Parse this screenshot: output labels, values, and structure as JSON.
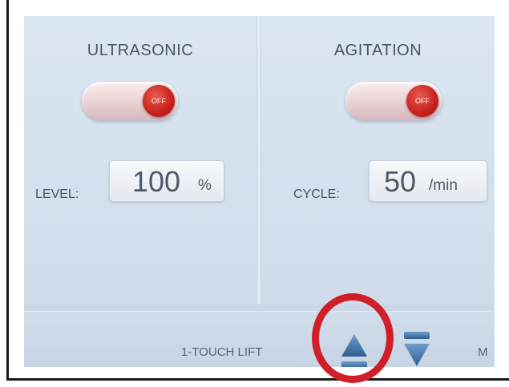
{
  "ultrasonic": {
    "title": "ULTRASONIC",
    "toggle_state": "OFF",
    "level_label": "LEVEL:",
    "level_value": "100",
    "level_unit": "%"
  },
  "agitation": {
    "title": "AGITATION",
    "toggle_state": "OFF",
    "cycle_label": "CYCLE:",
    "cycle_value": "50",
    "cycle_unit": "/min"
  },
  "bottom_bar": {
    "lift_label": "1-TOUCH LIFT",
    "truncated_label": "M"
  },
  "colors": {
    "toggle_knob": "#c8201c",
    "highlight_ring": "#d11f2a",
    "panel_bg": "#d6e2ef",
    "icon_blue": "#3f6fa0"
  }
}
